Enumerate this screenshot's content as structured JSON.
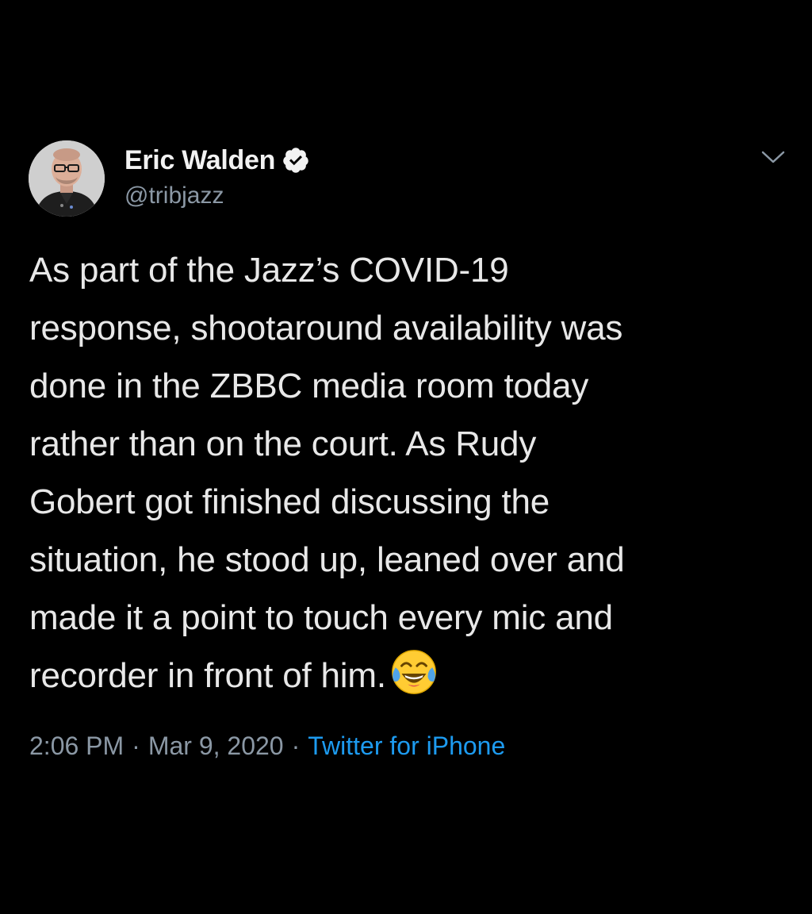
{
  "author": {
    "display_name": "Eric Walden",
    "handle": "@tribjazz",
    "verified": true,
    "avatar": "avatar-photo"
  },
  "tweet": {
    "lines": [
      "As part of the Jazz’s COVID-19",
      "response, shootaround availability was",
      "done in the ZBBC media room today",
      "rather than on the court. As Rudy",
      "Gobert got finished discussing the",
      "situation, he stood up, leaned over and",
      "made it a point to touch every mic and",
      "recorder in front of him."
    ],
    "emoji": "face-with-tears-of-joy-icon"
  },
  "meta": {
    "time": "2:06 PM",
    "separator": "·",
    "date": "Mar 9, 2020",
    "source": "Twitter for iPhone"
  },
  "colors": {
    "background": "#000000",
    "text": "#e8e8e8",
    "secondary_text": "#8b98a5",
    "link": "#1d9bf0"
  },
  "icons": {
    "verified": "verified-badge-icon",
    "menu": "chevron-down-icon"
  }
}
